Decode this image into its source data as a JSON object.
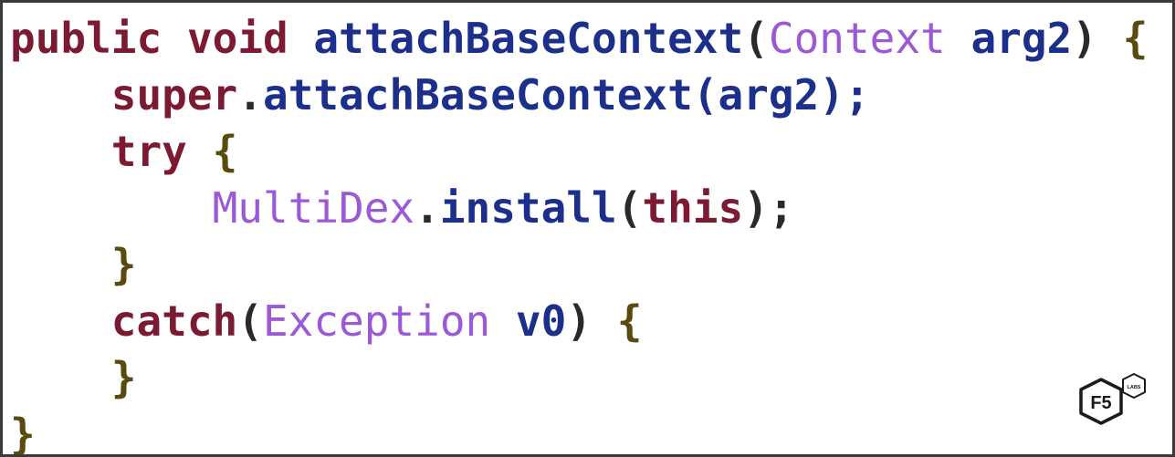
{
  "code": {
    "line1": {
      "kw1": "public",
      "kw2": "void",
      "name": "attachBaseContext",
      "open": "(",
      "type": "Context",
      "arg": "arg2",
      "close": ")",
      "brace": "{"
    },
    "line2": {
      "kw": "super",
      "dot": ".",
      "call": "attachBaseContext",
      "args": "(arg2);"
    },
    "line3": {
      "kw": "try",
      "brace": "{"
    },
    "line4": {
      "type": "MultiDex",
      "dot": ".",
      "call": "install",
      "open": "(",
      "kw": "this",
      "close": ");"
    },
    "line5": {
      "brace": "}"
    },
    "line6": {
      "kw": "catch",
      "open": "(",
      "type": "Exception",
      "var": "v0",
      "close": ")",
      "brace": "{"
    },
    "line7": {
      "brace": "}"
    },
    "line8": {
      "brace": "}"
    }
  },
  "logo": {
    "main": "F5",
    "badge": "LABS",
    "icon": "f5-labs-logo-icon"
  },
  "colors": {
    "keyword": "#7b1a30",
    "type": "#9b59d6",
    "identifier": "#1c2f8a",
    "border": "#3a3a3a"
  }
}
